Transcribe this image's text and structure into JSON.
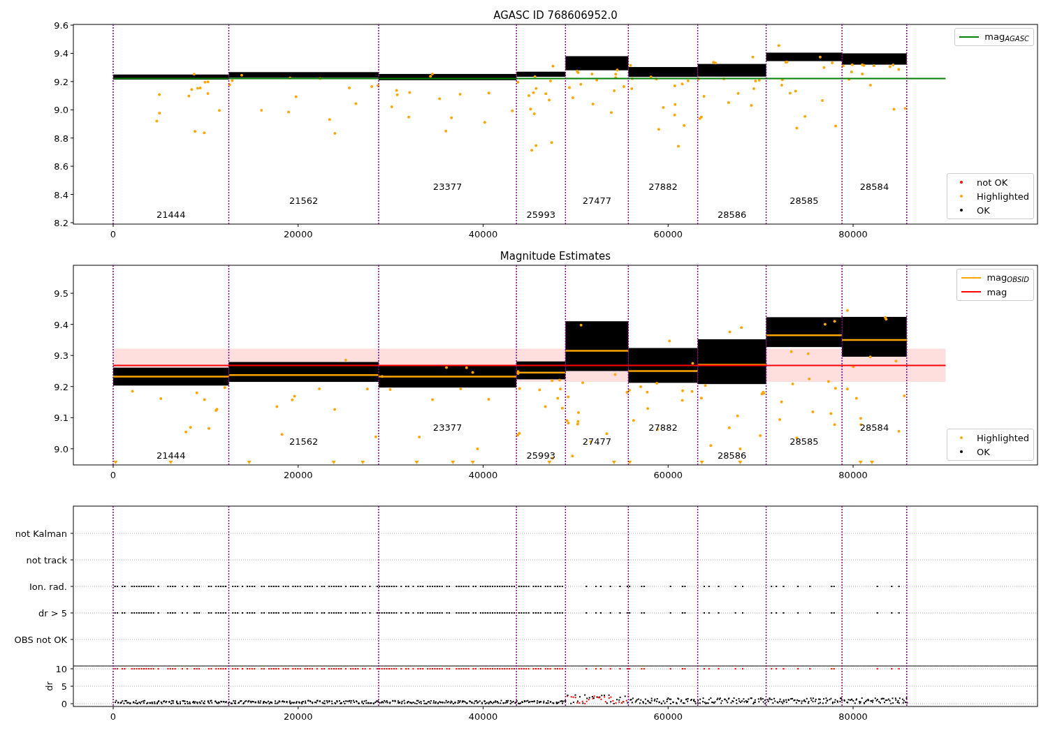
{
  "figure": {
    "panels": [
      {
        "kind": "mag",
        "title": "AGASC ID 768606952.0",
        "x_ticks": [
          "0",
          "20000",
          "40000",
          "60000",
          "80000"
        ],
        "y_ticks": [
          "9.6",
          "9.4",
          "9.2",
          "9.0",
          "8.8",
          "8.6",
          "8.4",
          "8.2"
        ],
        "obsids": [
          "21444",
          "21562",
          "23377",
          "25993",
          "27477",
          "27882",
          "28586",
          "28585",
          "28584"
        ],
        "legends": [
          {
            "entries": [
              {
                "kind": "line",
                "label": "mag$_{AGASC}$",
                "color": "#008000"
              }
            ]
          },
          {
            "entries": [
              {
                "kind": "dot",
                "label": "not OK",
                "color": "#ff0000"
              },
              {
                "kind": "dot",
                "label": "Highlighted",
                "color": "#ffa500"
              },
              {
                "kind": "dot",
                "label": "OK",
                "color": "#000000"
              }
            ]
          }
        ]
      },
      {
        "kind": "mag",
        "title": "Magnitude Estimates",
        "x_ticks": [
          "0",
          "20000",
          "40000",
          "60000",
          "80000"
        ],
        "y_ticks": [
          "9.5",
          "9.4",
          "9.3",
          "9.2",
          "9.1",
          "9.0"
        ],
        "obsids": [
          "21444",
          "21562",
          "23377",
          "25993",
          "27477",
          "27882",
          "28586",
          "28585",
          "28584"
        ],
        "legends": [
          {
            "entries": [
              {
                "kind": "line",
                "label": "mag$_{OBSID}$",
                "color": "#ffa500"
              },
              {
                "kind": "line",
                "label": "mag",
                "color": "#ff0000"
              }
            ]
          },
          {
            "entries": [
              {
                "kind": "dot",
                "label": "Highlighted",
                "color": "#ffa500"
              },
              {
                "kind": "dot",
                "label": "OK",
                "color": "#000000"
              }
            ]
          }
        ]
      },
      {
        "kind": "flags",
        "x_ticks": [
          "0",
          "20000",
          "40000",
          "60000",
          "80000"
        ],
        "categories": [
          "not Kalman",
          "not track",
          "Ion. rad.",
          "dr > 5",
          "OBS not OK"
        ],
        "dr_label": "dr",
        "dr_ticks": [
          "10",
          "5",
          "0"
        ]
      }
    ]
  }
}
